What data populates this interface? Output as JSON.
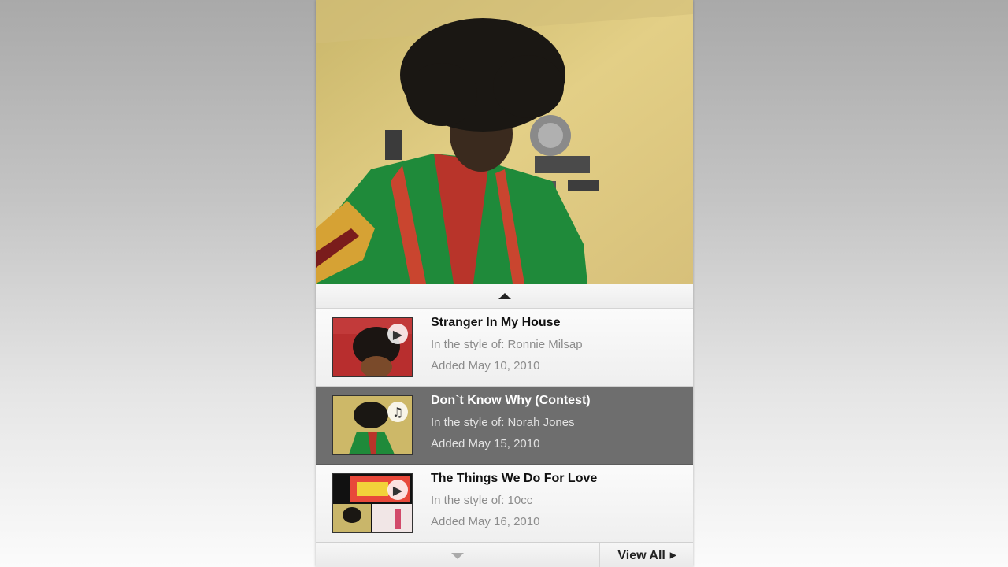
{
  "player": {
    "scroll_up_icon": "triangle-up-icon",
    "scroll_down_icon": "triangle-down-icon",
    "view_all_label": "View All",
    "view_all_icon": "chevron-right-icon",
    "selected_color": "#6e6e6e"
  },
  "playlist": [
    {
      "title": "Stranger In My House",
      "style": "In the style of: Ronnie Milsap",
      "added": "Added May 10, 2010",
      "badge_icon": "video-camera-icon",
      "selected": false
    },
    {
      "title": "Don`t Know Why (Contest)",
      "style": "In the style of: Norah Jones",
      "added": "Added May 15, 2010",
      "badge_icon": "music-note-icon",
      "selected": true
    },
    {
      "title": "The Things We Do For Love",
      "style": "In the style of: 10cc",
      "added": "Added May 16, 2010",
      "badge_icon": "video-camera-icon",
      "selected": false
    }
  ]
}
